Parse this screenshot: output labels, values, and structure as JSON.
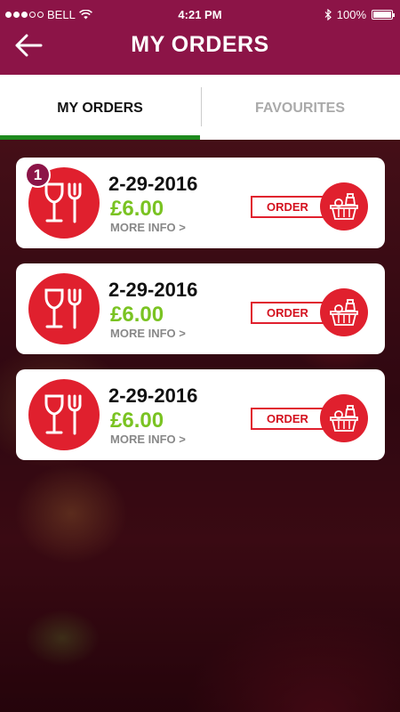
{
  "status_bar": {
    "carrier": "BELL",
    "time": "4:21 PM",
    "battery": "100%"
  },
  "header": {
    "title": "MY ORDERS"
  },
  "tabs": [
    {
      "label": "MY ORDERS",
      "active": true
    },
    {
      "label": "FAVOURITES",
      "active": false
    }
  ],
  "orders": [
    {
      "badge": "1",
      "date": "2-29-2016",
      "price": "£6.00",
      "more": "MORE INFO >",
      "action": "ORDER"
    },
    {
      "badge": "",
      "date": "2-29-2016",
      "price": "£6.00",
      "more": "MORE INFO >",
      "action": "ORDER"
    },
    {
      "badge": "",
      "date": "2-29-2016",
      "price": "£6.00",
      "more": "MORE INFO >",
      "action": "ORDER"
    }
  ],
  "colors": {
    "header": "#8c1447",
    "accent_red": "#e0202e",
    "price_green": "#7ac322",
    "tab_underline": "#1e8a1e"
  },
  "icons": {
    "back": "back-arrow-icon",
    "order_type": "glass-and-fork-icon",
    "basket": "food-basket-icon"
  }
}
